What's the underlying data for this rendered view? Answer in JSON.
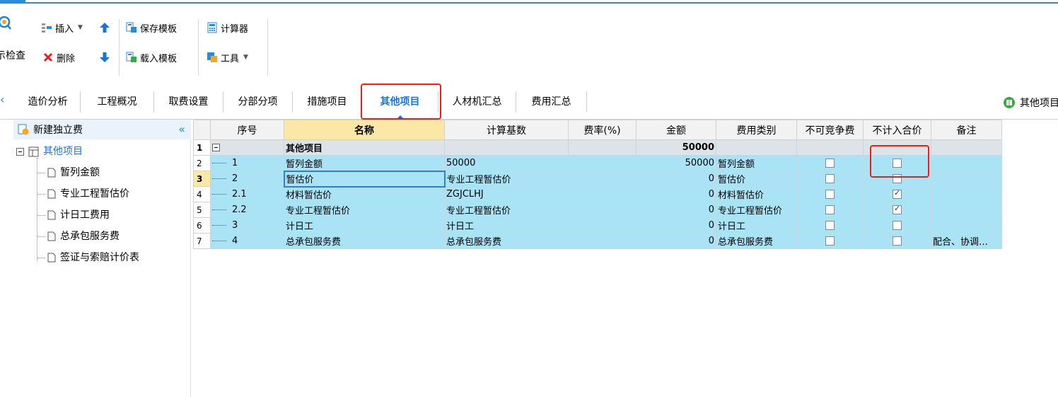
{
  "ribbon": {
    "check_label": "示检查",
    "insert_label": "插入",
    "delete_label": "删除",
    "save_template_label": "保存模板",
    "load_template_label": "载入模板",
    "calculator_label": "计算器",
    "tools_label": "工具"
  },
  "tabs": {
    "items": [
      "造价分析",
      "工程概况",
      "取费设置",
      "分部分项",
      "措施项目",
      "其他项目",
      "人材机汇总",
      "费用汇总"
    ],
    "right_label": "其他项目"
  },
  "sidebar": {
    "new_label": "新建独立费",
    "root": "其他项目",
    "children": [
      "暂列金额",
      "专业工程暂估价",
      "计日工费用",
      "总承包服务费",
      "签证与索赔计价表"
    ]
  },
  "grid": {
    "headers": [
      "序号",
      "名称",
      "计算基数",
      "费率(%)",
      "金额",
      "费用类别",
      "不可竞争费",
      "不计入合价",
      "备注"
    ],
    "rows": [
      {
        "rn": "1",
        "seq": "",
        "name": "其他项目",
        "base": "",
        "rate": "",
        "amount": "50000",
        "cat": "",
        "nc": false,
        "nj": false,
        "note": ""
      },
      {
        "rn": "2",
        "seq": "1",
        "name": "暂列金额",
        "base": "50000",
        "rate": "",
        "amount": "50000",
        "cat": "暂列金额",
        "nc": false,
        "nj": false,
        "note": ""
      },
      {
        "rn": "3",
        "seq": "2",
        "name": "暂估价",
        "base": "专业工程暂估价",
        "rate": "",
        "amount": "0",
        "cat": "暂估价",
        "nc": false,
        "nj": false,
        "note": ""
      },
      {
        "rn": "4",
        "seq": "2.1",
        "name": "材料暂估价",
        "base": "ZGJCLHJ",
        "rate": "",
        "amount": "0",
        "cat": "材料暂估价",
        "nc": false,
        "nj": true,
        "note": ""
      },
      {
        "rn": "5",
        "seq": "2.2",
        "name": "专业工程暂估价",
        "base": "专业工程暂估价",
        "rate": "",
        "amount": "0",
        "cat": "专业工程暂估价",
        "nc": false,
        "nj": true,
        "note": ""
      },
      {
        "rn": "6",
        "seq": "3",
        "name": "计日工",
        "base": "计日工",
        "rate": "",
        "amount": "0",
        "cat": "计日工",
        "nc": false,
        "nj": false,
        "note": ""
      },
      {
        "rn": "7",
        "seq": "4",
        "name": "总承包服务费",
        "base": "总承包服务费",
        "rate": "",
        "amount": "0",
        "cat": "总承包服务费",
        "nc": false,
        "nj": false,
        "note": "配合、协调…"
      }
    ]
  },
  "colors": {
    "accent": "#2b8bd6",
    "highlight_red": "#e8201c",
    "row_fill": "#a9e3f5"
  }
}
